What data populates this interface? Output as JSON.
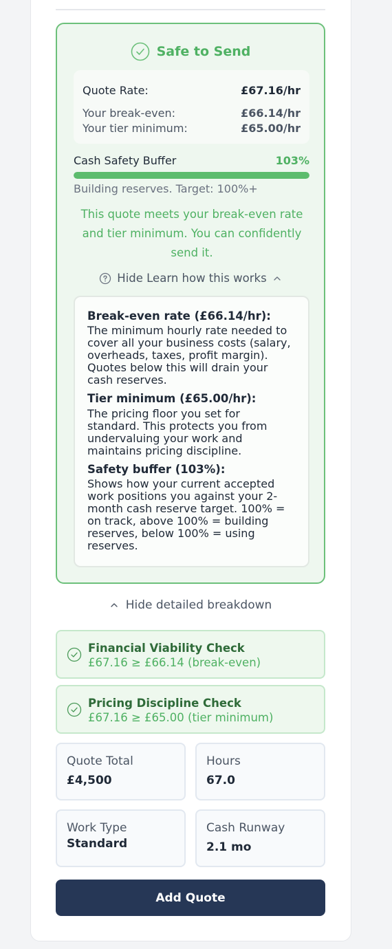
{
  "status": {
    "title": "Safe to Send",
    "accent_color": "#4fb163",
    "icon": "check-circle-icon"
  },
  "rates": {
    "quote_rate_label": "Quote Rate:",
    "quote_rate_value": "£67.16/hr",
    "break_even_label": "Your break-even:",
    "break_even_value": "£66.14/hr",
    "tier_min_label": "Your tier minimum:",
    "tier_min_value": "£65.00/hr"
  },
  "buffer": {
    "label": "Cash Safety Buffer",
    "percent_text": "103%",
    "fill_percent": 100,
    "note": "Building reserves. Target: 100%+"
  },
  "message": "This quote meets your break-even rate and tier minimum. You can confidently send it.",
  "learn": {
    "toggle_label": "Hide Learn how this works",
    "sections": [
      {
        "heading": "Break-even rate (£66.14/hr):",
        "body": "The minimum hourly rate needed to cover all your business costs (salary, overheads, taxes, profit margin). Quotes below this will drain your cash reserves."
      },
      {
        "heading": "Tier minimum (£65.00/hr):",
        "body": "The pricing floor you set for standard. This protects you from undervaluing your work and maintains pricing discipline."
      },
      {
        "heading": "Safety buffer (103%):",
        "body": "Shows how your current accepted work positions you against your 2-month cash reserve target. 100% = on track, above 100% = building reserves, below 100% = using reserves."
      }
    ]
  },
  "breakdown": {
    "toggle_label": "Hide detailed breakdown",
    "checks": [
      {
        "title": "Financial Viability Check",
        "detail": "£67.16 ≥ £66.14 (break-even)"
      },
      {
        "title": "Pricing Discipline Check",
        "detail": "£67.16 ≥ £65.00 (tier minimum)"
      }
    ]
  },
  "stats": {
    "quote_total": {
      "label": "Quote Total",
      "value": "£4,500"
    },
    "hours": {
      "label": "Hours",
      "value": "67.0"
    },
    "work_type": {
      "label": "Work Type",
      "value": "Standard"
    },
    "cash_runway": {
      "label": "Cash Runway",
      "value": "2.1 mo"
    }
  },
  "actions": {
    "add_quote_label": "Add Quote",
    "button_color": "#263756"
  }
}
